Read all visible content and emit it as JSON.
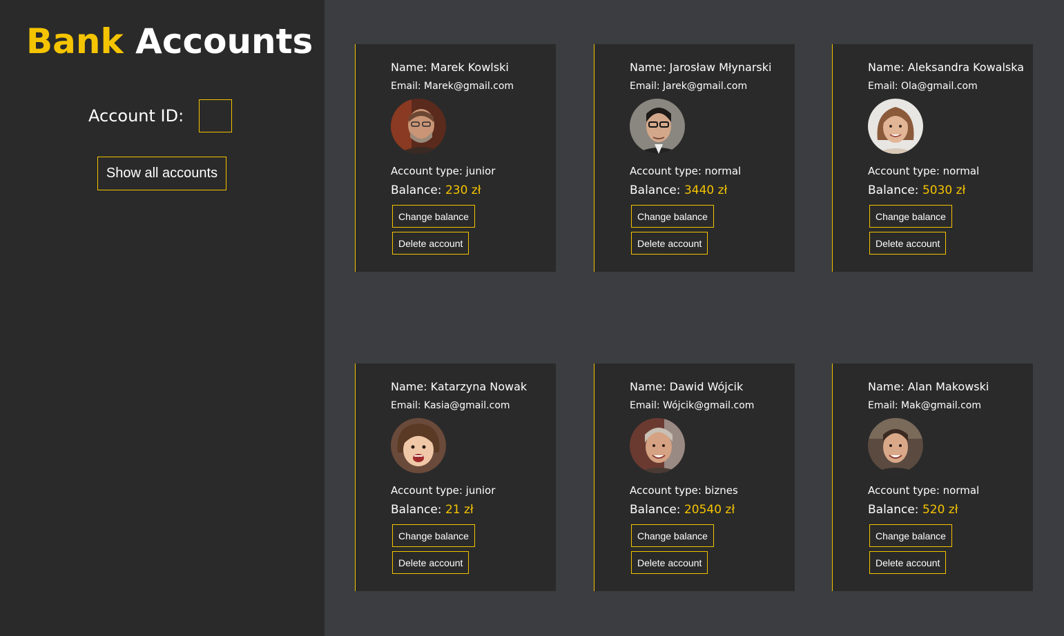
{
  "header": {
    "title_accent": "Bank",
    "title_rest": "Accounts"
  },
  "sidebar": {
    "account_id_label": "Account ID:",
    "account_id_value": "",
    "show_all_label": "Show all accounts"
  },
  "colors": {
    "accent": "#f5c400",
    "sidebar_bg": "#2a2a2a",
    "main_bg": "#3b3d40"
  },
  "accounts": [
    {
      "name_label": "Name: Marek Kowlski",
      "email_label": "Email: Marek@gmail.com",
      "avatar": "avatar-photo-man-glasses-beard",
      "type_label": "Account type: junior",
      "balance_prefix": "Balance: ",
      "balance_amount": "230 zł",
      "change_label": "Change balance",
      "delete_label": "Delete account"
    },
    {
      "name_label": "Name: Jarosław Młynarski",
      "email_label": "Email: Jarek@gmail.com",
      "avatar": "avatar-photo-man-glasses",
      "type_label": "Account type: normal",
      "balance_prefix": "Balance: ",
      "balance_amount": "3440 zł",
      "change_label": "Change balance",
      "delete_label": "Delete account"
    },
    {
      "name_label": "Name: Aleksandra Kowalska",
      "email_label": "Email: Ola@gmail.com",
      "avatar": "avatar-photo-woman",
      "type_label": "Account type: normal",
      "balance_prefix": "Balance: ",
      "balance_amount": "5030 zł",
      "change_label": "Change balance",
      "delete_label": "Delete account"
    },
    {
      "name_label": "Name: Katarzyna Nowak",
      "email_label": "Email: Kasia@gmail.com",
      "avatar": "avatar-photo-child",
      "type_label": "Account type: junior",
      "balance_prefix": "Balance: ",
      "balance_amount": "21 zł",
      "change_label": "Change balance",
      "delete_label": "Delete account"
    },
    {
      "name_label": "Name: Dawid Wójcik",
      "email_label": "Email: Wójcik@gmail.com",
      "avatar": "avatar-photo-man-gray-hair",
      "type_label": "Account type: biznes",
      "balance_prefix": "Balance: ",
      "balance_amount": "20540 zł",
      "change_label": "Change balance",
      "delete_label": "Delete account"
    },
    {
      "name_label": "Name: Alan Makowski",
      "email_label": "Email: Mak@gmail.com",
      "avatar": "avatar-photo-man-smiling",
      "type_label": "Account type: normal",
      "balance_prefix": "Balance: ",
      "balance_amount": "520 zł",
      "change_label": "Change balance",
      "delete_label": "Delete account"
    }
  ]
}
